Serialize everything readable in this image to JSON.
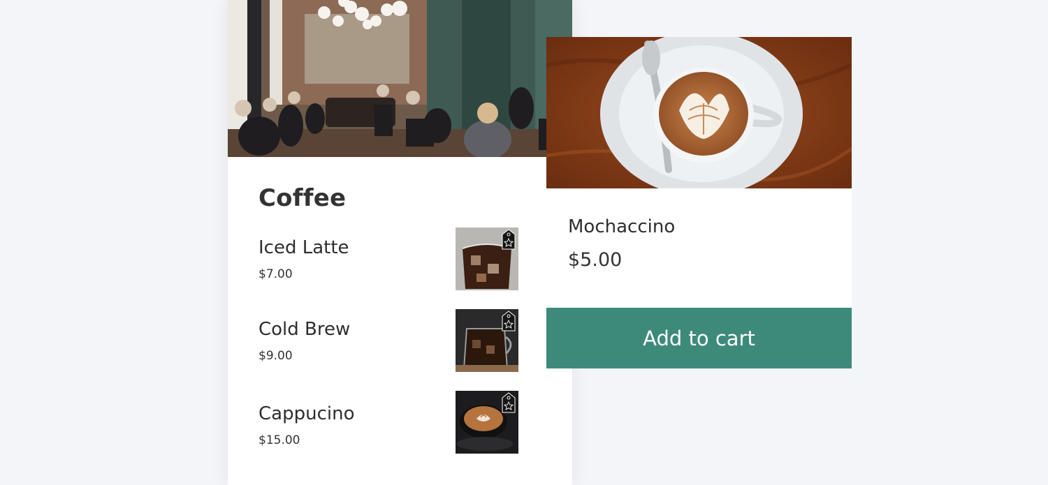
{
  "menu": {
    "title": "Coffee",
    "items": [
      {
        "name": "Iced Latte",
        "price": "$7.00",
        "image": "iced-latte-thumbnail",
        "badge_icon": "tag-star-icon"
      },
      {
        "name": "Cold Brew",
        "price": "$9.00",
        "image": "cold-brew-thumbnail",
        "badge_icon": "tag-star-icon"
      },
      {
        "name": "Cappucino",
        "price": "$15.00",
        "image": "cappucino-thumbnail",
        "badge_icon": "tag-star-icon"
      }
    ],
    "hero_image": "cafe-interior-photo"
  },
  "product": {
    "name": "Mochaccino",
    "price": "$5.00",
    "image": "latte-art-cup-photo",
    "cart_label": "Add to cart"
  },
  "colors": {
    "background": "#f4f5f8",
    "card": "#ffffff",
    "accent": "#3d8a7b",
    "text": "#2e2e2e"
  }
}
